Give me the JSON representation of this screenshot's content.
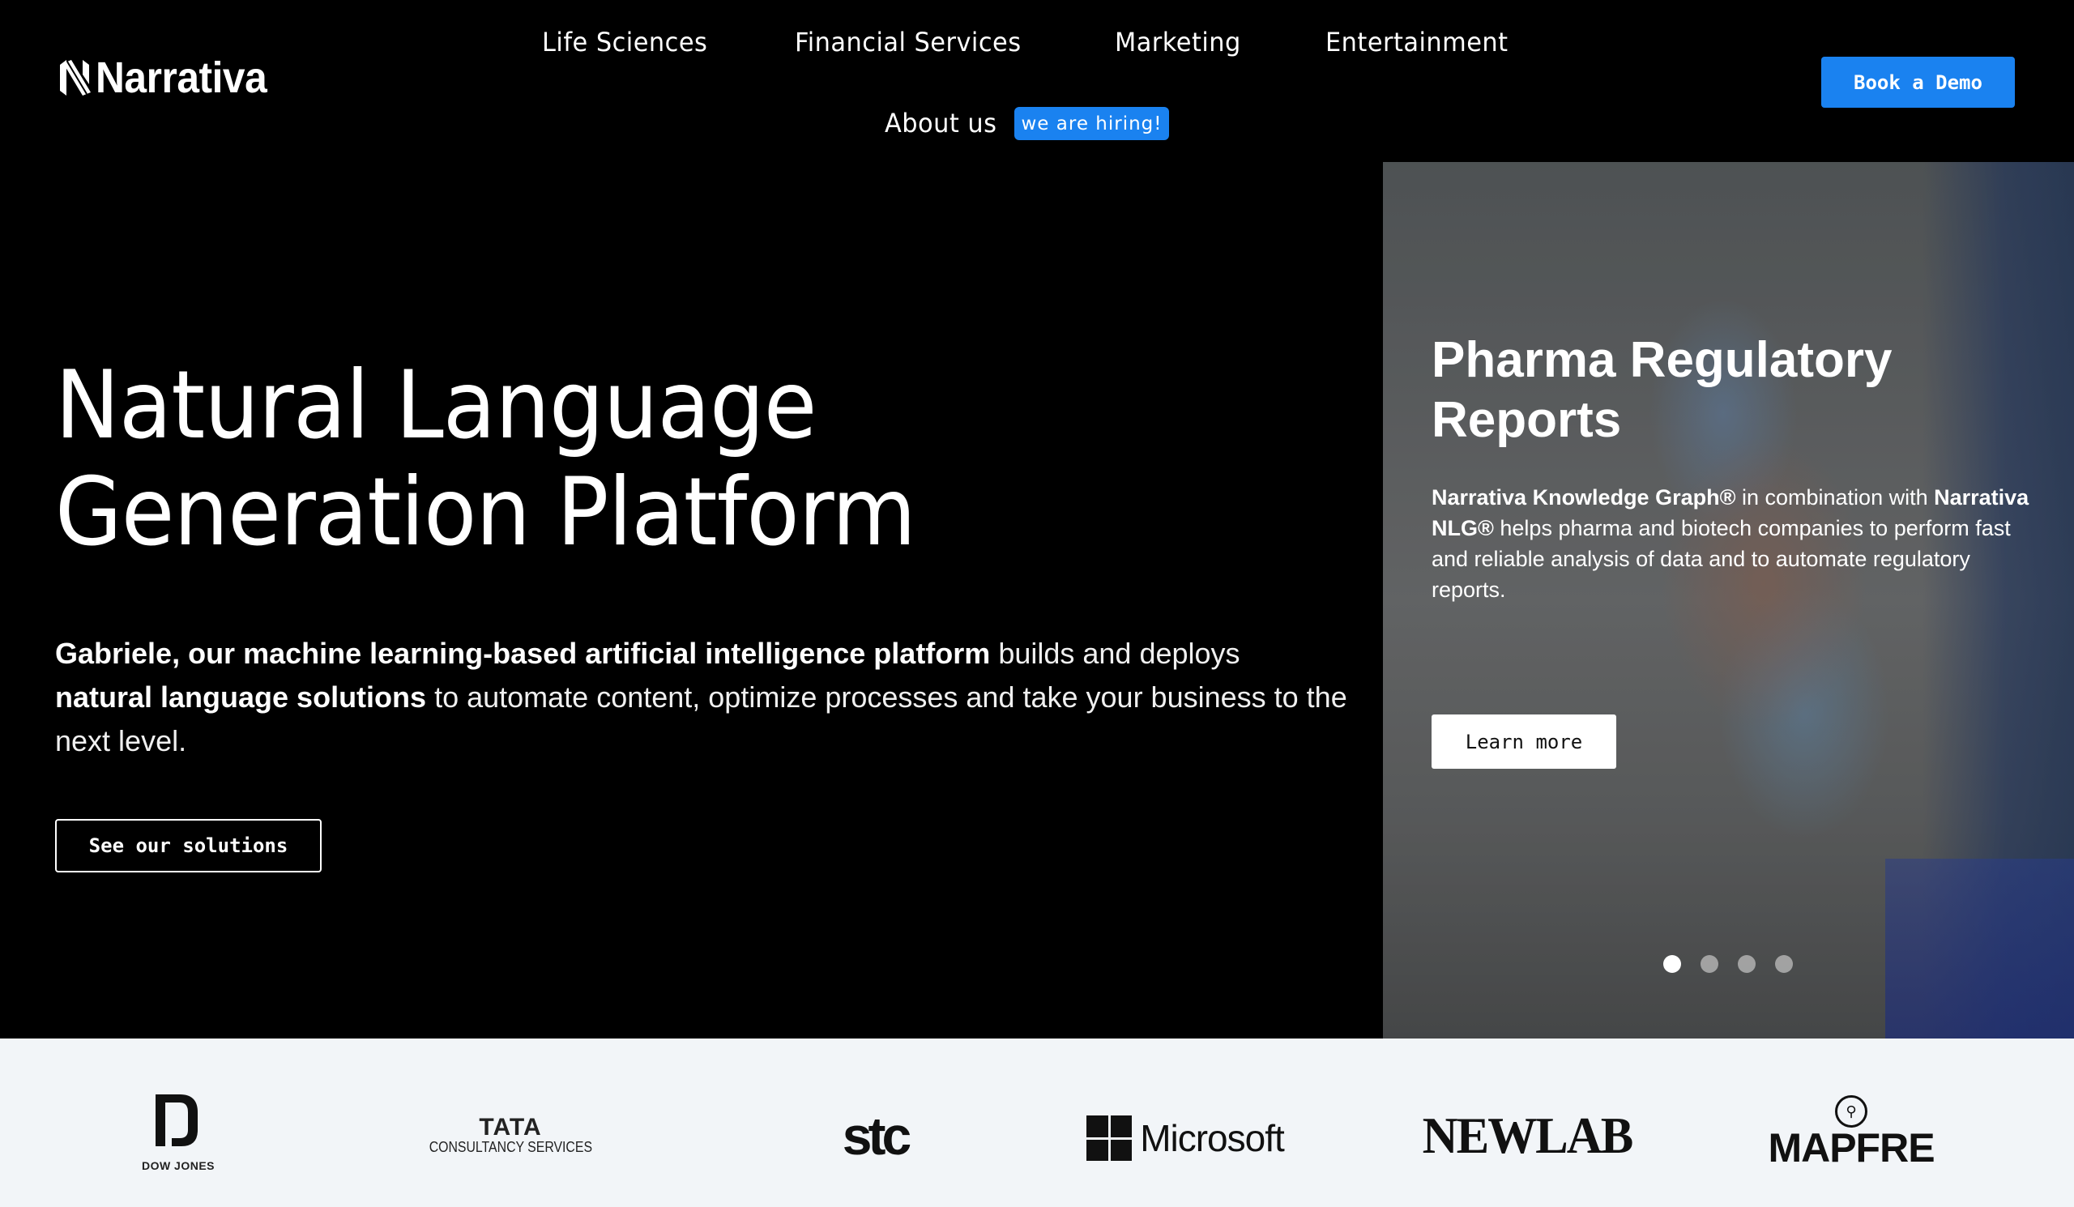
{
  "header": {
    "brand": "Narrativa",
    "nav": [
      {
        "label": "Life Sciences"
      },
      {
        "label": "Financial Services"
      },
      {
        "label": "Marketing"
      },
      {
        "label": "Entertainment"
      },
      {
        "label": "About us"
      }
    ],
    "hiring_badge": "we are hiring!",
    "cta_label": "Book a Demo",
    "accent_color": "#1a82f0"
  },
  "hero": {
    "title_line1": "Natural Language",
    "title_line2": "Generation Platform",
    "description": {
      "bold1": "Gabriele, our machine learning-based artificial intelligence platform",
      "text1": " builds and deploys ",
      "bold2": "natural language solutions",
      "text2": " to automate content, optimize processes and take your business to the next level."
    },
    "cta_label": "See our solutions"
  },
  "carousel": {
    "title": "Pharma Regulatory Reports",
    "text": {
      "bold1": "Narrativa Knowledge Graph®",
      "text1": " in combination with ",
      "bold2": "Narrativa NLG®",
      "text2": " helps pharma and biotech companies to perform fast and reliable analysis of data and to automate regulatory reports."
    },
    "cta_label": "Learn more",
    "slide_count": 4,
    "active_slide": 1
  },
  "clients": {
    "logos": [
      {
        "name": "Dow Jones",
        "label": "DOW JONES"
      },
      {
        "name": "Tata Consultancy Services",
        "main": "TATA",
        "sub": "CONSULTANCY SERVICES"
      },
      {
        "name": "stc",
        "label": "stc"
      },
      {
        "name": "Microsoft",
        "label": "Microsoft"
      },
      {
        "name": "Newlab",
        "label": "NEWLAB"
      },
      {
        "name": "Mapfre",
        "label": "MAPFRE"
      }
    ]
  }
}
